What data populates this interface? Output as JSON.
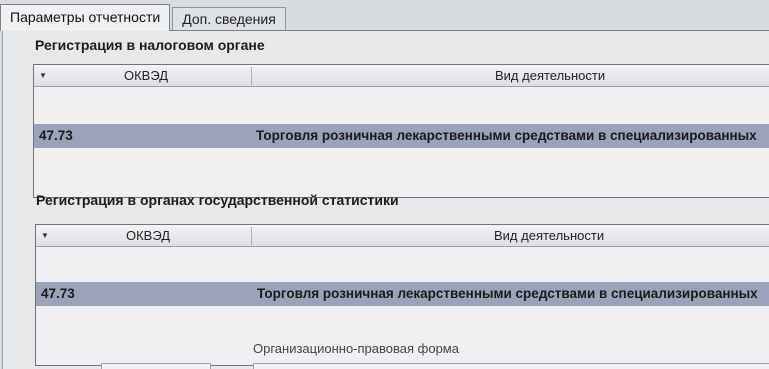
{
  "tabs": [
    {
      "label": "Параметры отчетности"
    },
    {
      "label": "Доп. сведения"
    }
  ],
  "tax_registration": {
    "title": "Регистрация в налоговом органе",
    "columns": {
      "code": "ОКВЭД",
      "activity": "Вид деятельности"
    },
    "rows": [
      {
        "code": "47.73",
        "activity": "Торговля розничная лекарственными средствами в специализированных"
      }
    ]
  },
  "stat_registration": {
    "title": "Регистрация в органах государственной статистики",
    "columns": {
      "code": "ОКВЭД",
      "activity": "Вид деятельности"
    },
    "rows": [
      {
        "code": "47.73",
        "activity": "Торговля розничная лекарственными средствами в специализированных"
      }
    ]
  },
  "legal_form": {
    "label": "Организационно-правовая форма"
  },
  "colors": {
    "selected_row": "#9aa3ba",
    "background": "#e6e8ea"
  }
}
